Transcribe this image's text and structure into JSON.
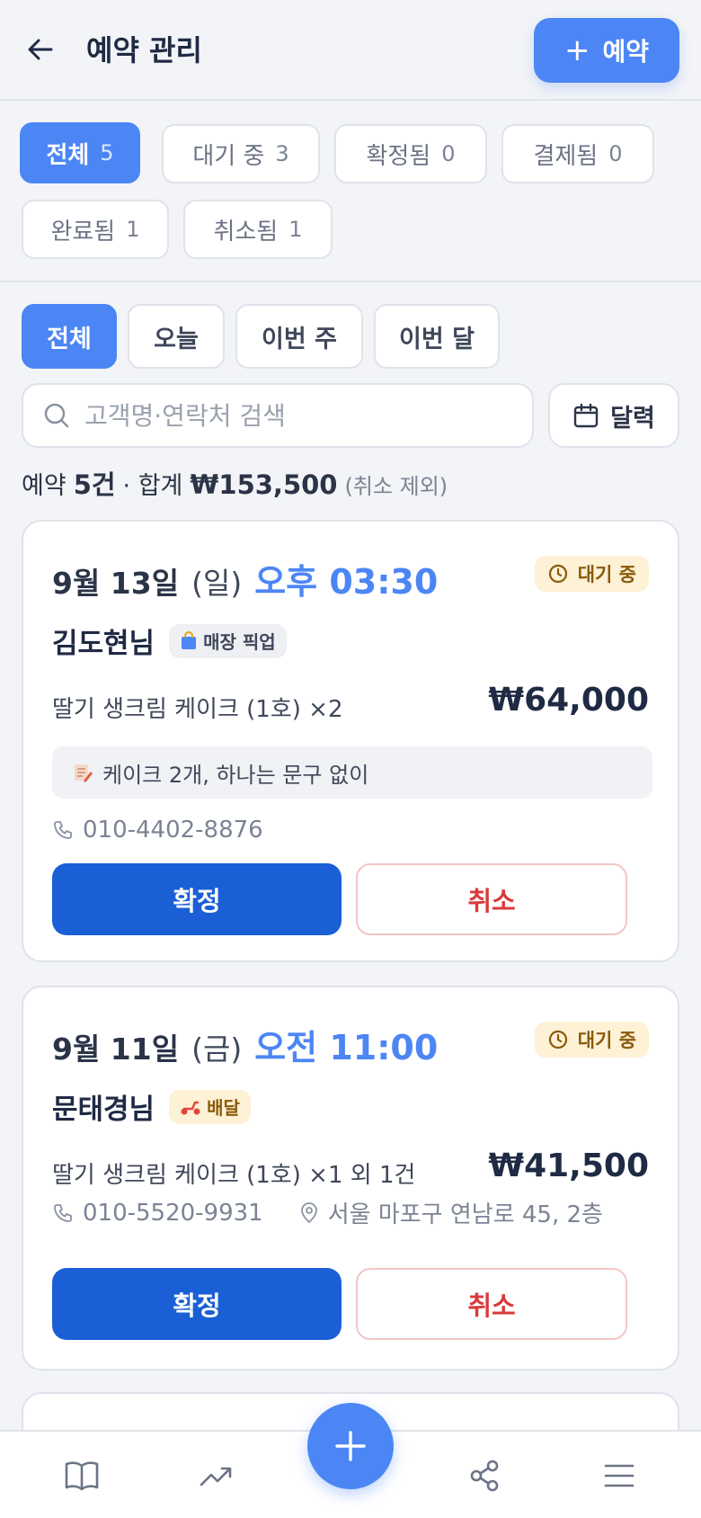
{
  "header": {
    "title": "예약 관리",
    "add_label": "예약",
    "add_icon": "plus-icon"
  },
  "status_filters": [
    {
      "label": "전체",
      "count": "5",
      "active": true
    },
    {
      "label": "대기 중",
      "count": "3"
    },
    {
      "label": "확정됨",
      "count": "0"
    },
    {
      "label": "결제됨",
      "count": "0"
    },
    {
      "label": "완료됨",
      "count": "1"
    },
    {
      "label": "취소됨",
      "count": "1"
    }
  ],
  "period_filters": [
    {
      "label": "전체",
      "active": true
    },
    {
      "label": "오늘"
    },
    {
      "label": "이번 주"
    },
    {
      "label": "이번 달"
    }
  ],
  "search": {
    "placeholder": "고객명·연락처 검색",
    "value": ""
  },
  "calendar_label": "달력",
  "summary": {
    "prefix": "예약",
    "count": "5건",
    "mid": "· 합계",
    "total": "₩153,500",
    "note": "(취소 제외)"
  },
  "reservations": [
    {
      "date": "9월 13일",
      "weekday": "(일)",
      "time": "오후 03:30",
      "status": "대기 중",
      "customer": "김도현님",
      "type": "매장 픽업",
      "item": "딸기 생크림 케이크 (1호) ×2",
      "price": "₩64,000",
      "memo": "케이크 2개, 하나는 문구 없이",
      "phone": "010-4402-8876",
      "confirm_label": "확정",
      "cancel_label": "취소"
    },
    {
      "date": "9월 11일",
      "weekday": "(금)",
      "time": "오전 11:00",
      "status": "대기 중",
      "customer": "문태경님",
      "type": "배달",
      "item": "딸기 생크림 케이크 (1호) ×1 외 1건",
      "price": "₩41,500",
      "phone": "010-5520-9931",
      "address": "서울 마포구 연남로 45, 2층",
      "confirm_label": "확정",
      "cancel_label": "취소"
    }
  ],
  "colors": {
    "accent": "#4c86f5",
    "confirm": "#1a5fd6",
    "cancel": "#d93a3a",
    "wait_bg": "#fdf1d6"
  },
  "bottom_nav": [
    "book-icon",
    "trending-icon",
    "plus-icon",
    "share-icon",
    "menu-icon"
  ]
}
